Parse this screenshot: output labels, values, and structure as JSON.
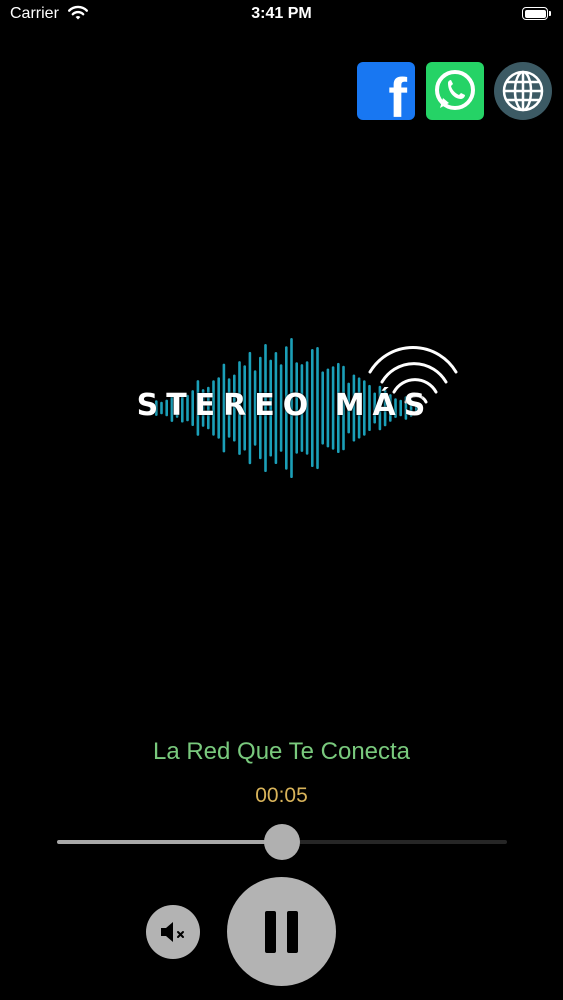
{
  "status_bar": {
    "carrier": "Carrier",
    "time": "3:41 PM"
  },
  "social": {
    "facebook_icon": "facebook-icon",
    "whatsapp_icon": "whatsapp-icon",
    "website_icon": "globe-icon"
  },
  "logo": {
    "text": "STEREO MÁS"
  },
  "player": {
    "slogan": "La Red Que Te Conecta",
    "elapsed": "00:05",
    "progress": 0.5,
    "mute_icon": "speaker-muted-icon",
    "pause_icon": "pause-icon"
  },
  "colors": {
    "background": "#000000",
    "slogan": "#79c97d",
    "elapsed": "#d8b35a",
    "wave": "#1b9fb8",
    "controls": "#b3b3b3"
  }
}
